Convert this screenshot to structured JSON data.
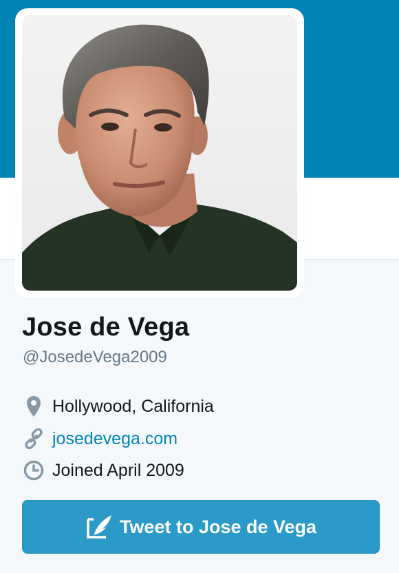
{
  "profile": {
    "name": "Jose de Vega",
    "handle": "@JosedeVega2009",
    "location": "Hollywood, California",
    "website": "josedevega.com",
    "joined": "Joined April 2009",
    "avatar_icon": "profile-photo"
  },
  "actions": {
    "tweet_to_label": "Tweet to Jose de Vega"
  },
  "colors": {
    "banner": "#0084b4",
    "link": "#0084b4",
    "button": "#2b9ac8",
    "muted": "#657786"
  },
  "icons": {
    "location": "map-pin-icon",
    "website": "link-icon",
    "joined": "clock-icon",
    "tweet": "quill-icon"
  }
}
